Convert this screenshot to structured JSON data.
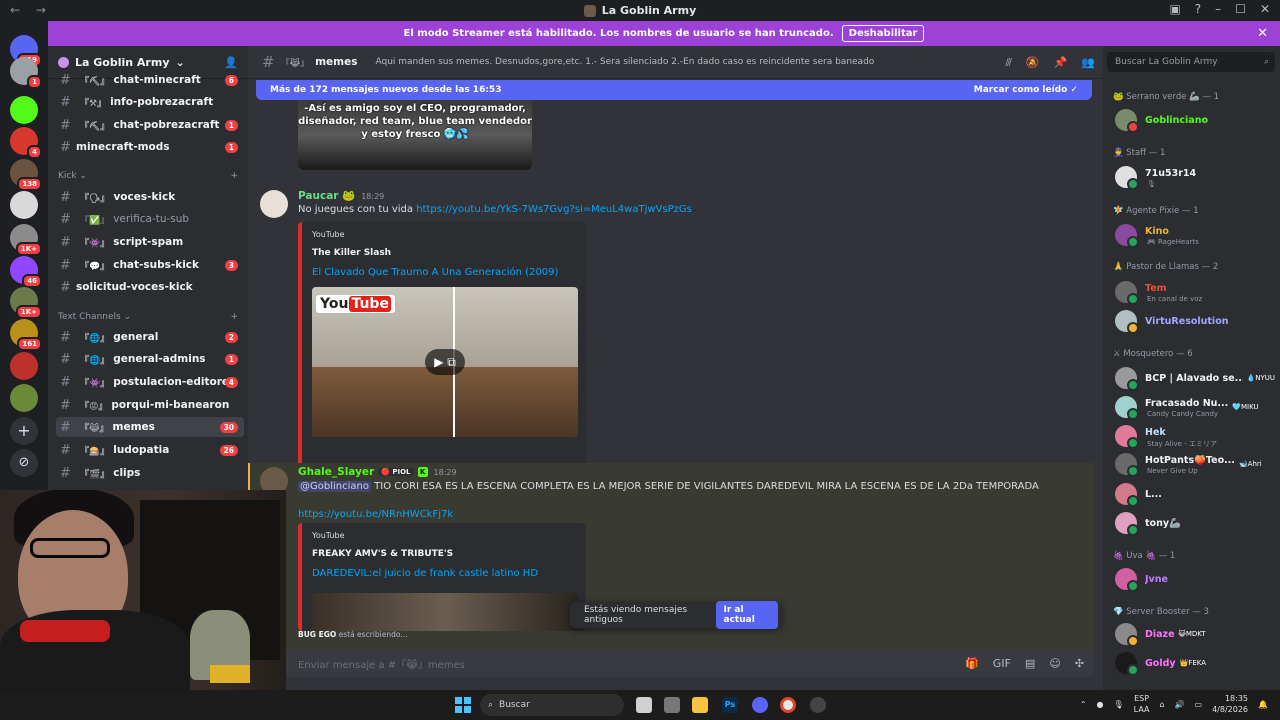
{
  "titlebar": {
    "title": "La Goblin Army",
    "nav": "← →"
  },
  "streamer": {
    "text": "El modo Streamer está habilitado. Los nombres de usuario se han truncado.",
    "button": "Deshabilitar"
  },
  "guilds": [
    {
      "badge": "519",
      "color": "#5865f2"
    },
    {
      "badge": "1",
      "color": "#9aa0a6"
    },
    {
      "badge": "",
      "color": "#53fc18"
    },
    {
      "badge": "4",
      "color": "#d7382e"
    },
    {
      "badge": "138",
      "color": "#6b5340"
    },
    {
      "badge": "",
      "color": "#d9d9d9"
    },
    {
      "badge": "1K+",
      "color": "#8b8b8b"
    },
    {
      "badge": "46",
      "color": "#9146ff"
    },
    {
      "badge": "1K+",
      "color": "#6a7a4a"
    },
    {
      "badge": "161",
      "color": "#b8901a"
    },
    {
      "badge": "",
      "color": "#c0302a"
    },
    {
      "badge": "",
      "color": "#6a8a3a"
    }
  ],
  "server": {
    "name": "La Goblin Army"
  },
  "channels": [
    {
      "name": "chat-minecraft",
      "emoji": "『⛏』",
      "count": "6",
      "unread": true
    },
    {
      "name": "info-pobrezacraft",
      "emoji": "『⚒』",
      "count": "",
      "unread": true
    },
    {
      "name": "chat-pobrezacraft",
      "emoji": "『⛏』",
      "count": "1",
      "unread": true
    },
    {
      "name": "minecraft-mods",
      "emoji": "",
      "count": "1",
      "unread": true
    },
    {
      "name": "voces-kick",
      "emoji": "『🗣』",
      "count": "",
      "unread": true
    },
    {
      "name": "verifica-tu-sub",
      "emoji": "『✅』",
      "count": "",
      "unread": false
    },
    {
      "name": "script-spam",
      "emoji": "『👾』",
      "count": "",
      "unread": true
    },
    {
      "name": "chat-subs-kick",
      "emoji": "『💬』",
      "count": "3",
      "unread": true
    },
    {
      "name": "solicitud-voces-kick",
      "emoji": "",
      "count": "",
      "unread": true
    },
    {
      "name": "general",
      "emoji": "『🌐』",
      "count": "2",
      "unread": true
    },
    {
      "name": "general-admins",
      "emoji": "『🌐』",
      "count": "1",
      "unread": true
    },
    {
      "name": "postulacion-editores",
      "emoji": "『👾』",
      "count": "4",
      "unread": true
    },
    {
      "name": "porqui-mi-banearon",
      "emoji": "『😡』",
      "count": "",
      "unread": true
    },
    {
      "name": "memes",
      "emoji": "『😹』",
      "count": "30",
      "unread": true
    },
    {
      "name": "ludopatia",
      "emoji": "『🎰』",
      "count": "26",
      "unread": true
    },
    {
      "name": "clips",
      "emoji": "『🎬』",
      "count": "",
      "unread": true
    }
  ],
  "categories": {
    "kick": "Kick",
    "text": "Text Channels"
  },
  "chat": {
    "channel": "memes",
    "channel_emoji": "『😹』",
    "topic": "Aqui manden sus memes. Desnudos,gore,etc. 1.- Sera silenciado 2.-En dado caso es reincidente sera baneado",
    "newbar": "Más de 172 mensajes nuevos desde las 16:53",
    "mark_read": "Marcar como leído",
    "image_text": "-Así es amigo soy el CEO, programador, diseñador, red team, blue team  vendedor y estoy fresco 🥶💦",
    "msg1": {
      "user": "Paucar",
      "time": "18:29",
      "text": "No juegues con tu vida ",
      "link": "https://youtu.be/YkS-7Ws7Gvg?si=MeuL4waTjwVsPzGs",
      "embed": {
        "provider": "YouTube",
        "author": "The Killer Slash",
        "title": "El Clavado Que Traumo A Una Generación (2009)"
      }
    },
    "msg2": {
      "user": "Ghale_Slayer",
      "tag": "PIOL",
      "time": "18:29",
      "mention": "@Goblinciano",
      "text": " TIO CORI ESA ES LA ESCENA COMPLETA ES LA MEJOR SERIE DE VIGILANTES DAREDEVIL MIRA LA ESCENA ES DE LA 2Da TEMPORADA",
      "link": "https://youtu.be/NRnHWCkFj7k",
      "embed": {
        "provider": "YouTube",
        "author": "FREAKY AMV'S & TRIBUTE'S",
        "title": "DAREDEVIL:el juicio de frank castle latino HD"
      }
    },
    "old_messages": "Estás viendo mensajes antiguos",
    "go_current": "Ir al actual",
    "typing_user": "BUG EGO",
    "typing_text": " está escribiendo...",
    "placeholder": "Enviar mensaje a #『😹』memes"
  },
  "members": {
    "search": "Buscar La Goblin Army",
    "roles": [
      {
        "title": "🐸 Serrano verde 🦾 — 1"
      },
      {
        "title": "👮 Staff — 1"
      },
      {
        "title": "🧚 Agente Pixie — 1"
      },
      {
        "title": "🙏 Pastor de Llamas — 2"
      },
      {
        "title": "⚔ Mosquetero — 6"
      },
      {
        "title": "🍇 Uva 🍇 — 1"
      },
      {
        "title": "💎 Server Booster — 3"
      }
    ],
    "list": [
      {
        "name": "Goblinciano",
        "color": "#53fc18",
        "status": "",
        "tag": "",
        "avatar": "#7a8a6a",
        "st": "#f23f43"
      },
      {
        "name": "71u53r14",
        "color": "#f2f3f5",
        "status": "🎙",
        "tag": "",
        "avatar": "#e0e0e0",
        "st": "#23a55a"
      },
      {
        "name": "Kino",
        "color": "#f0b232",
        "status": "🎮 RageHearts",
        "tag": "",
        "avatar": "#8a4aa0",
        "st": "#23a55a"
      },
      {
        "name": "Tem",
        "color": "#e8503a",
        "status": "En canal de voz",
        "tag": "",
        "avatar": "#6a6a6a",
        "st": "#23a55a"
      },
      {
        "name": "VirtuResolution",
        "color": "#a0a8ff",
        "status": "",
        "tag": "",
        "avatar": "#b0c0c0",
        "st": "#f0b232"
      },
      {
        "name": "BCP | Alavado se...",
        "color": "#f2f3f5",
        "status": "",
        "tag": "💧NYUU",
        "avatar": "#9a9a9a",
        "st": "#23a55a"
      },
      {
        "name": "Fracasado Nu...",
        "color": "#f2f3f5",
        "status": "Candy Candy Candy",
        "tag": "🩵MIKU",
        "avatar": "#a0d0d0",
        "st": "#23a55a"
      },
      {
        "name": "Hek",
        "color": "#c0e0ff",
        "status": "Stay Alive - エミリア",
        "tag": "",
        "avatar": "#e07a9a",
        "st": "#23a55a"
      },
      {
        "name": "HotPants🍑Teo...",
        "color": "#f2f3f5",
        "status": "Never Give Up",
        "tag": "🐋Ahri",
        "avatar": "#6a6a6a",
        "st": "#23a55a"
      },
      {
        "name": "L...",
        "color": "#f2f3f5",
        "status": "",
        "tag": "",
        "avatar": "#d07a8a",
        "st": "#23a55a"
      },
      {
        "name": "tony🦾",
        "color": "#f2f3f5",
        "status": "",
        "tag": "",
        "avatar": "#e0a0c0",
        "st": "#23a55a"
      },
      {
        "name": "Jvne",
        "color": "#c080ff",
        "status": "",
        "tag": "",
        "avatar": "#d060a0",
        "st": "#23a55a"
      },
      {
        "name": "Diaze",
        "color": "#ff73fa",
        "status": "",
        "tag": "😺MDKT",
        "avatar": "#8a8a8a",
        "st": "#f0b232"
      },
      {
        "name": "Goldy",
        "color": "#ff73fa",
        "status": "",
        "tag": "👑FEKA",
        "avatar": "#1a1a1a",
        "st": "#23a55a"
      }
    ]
  },
  "taskbar": {
    "search": "Buscar",
    "lang1": "ESP",
    "lang2": "LAA",
    "time": "18:35",
    "date": "4/8/2026"
  }
}
